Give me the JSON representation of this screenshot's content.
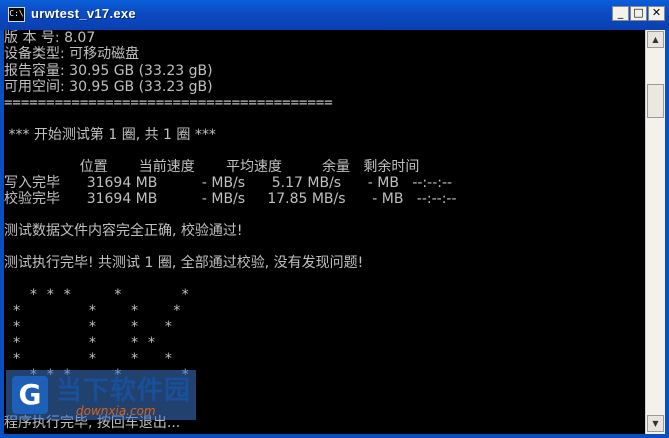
{
  "window": {
    "title": "urwtest_v17.exe",
    "icon_text": "C:\\",
    "buttons": {
      "minimize": "_",
      "maximize": "□",
      "close": "✕"
    }
  },
  "console": {
    "lines": [
      "版 本 号: 8.07",
      "设备类型: 可移动磁盘",
      "报告容量: 30.95 GB (33.23 gB)",
      "可用空间: 30.95 GB (33.23 gB)",
      "=======================================",
      "",
      " *** 开始测试第 1 圈, 共 1 圈 ***",
      "",
      "                 位置       当前速度       平均速度         余量   剩余时间",
      "写入完毕      31694 MB          - MB/s      5.17 MB/s      - MB   --:--:--",
      "校验完毕      31694 MB          - MB/s     17.85 MB/s      - MB   --:--:--",
      "",
      "测试数据文件内容完全正确, 校验通过!",
      "",
      "测试执行完毕! 共测试 1 圈, 全部通过校验, 没有发现问题!",
      "",
      "",
      "   * * *     *       *",
      " *        *    *    *",
      " *        *    *   *",
      " *        *    * *",
      " *        *    *   *",
      "   * * *     *       *",
      "程序执行完毕, 按回车退出..."
    ]
  },
  "scrollbar": {
    "up_arrow": "▲",
    "down_arrow": "▼"
  },
  "watermark": {
    "logo": "G",
    "title": "当下软件园",
    "url": "downxia.com"
  }
}
